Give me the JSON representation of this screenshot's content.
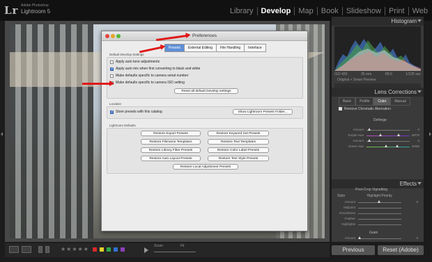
{
  "app": {
    "logo": "Lr",
    "vendor": "Adobe Photoshop",
    "product": "Lightroom 5",
    "modules": [
      "Library",
      "Develop",
      "Map",
      "Book",
      "Slideshow",
      "Print",
      "Web"
    ],
    "active_module": "Develop"
  },
  "right_panel": {
    "histogram_title": "Histogram",
    "hist_info": [
      "ISO 400",
      "35 mm",
      "f/8.0",
      "1/125 sec"
    ],
    "original_label": "Original + Smart Preview",
    "lens_title": "Lens Corrections",
    "lens_tabs": [
      "Basic",
      "Profile",
      "Color",
      "Manual"
    ],
    "lens_active_tab": "Color",
    "remove_ca": "Remove Chromatic Aberration",
    "defringe": "Defringe",
    "sliders": [
      {
        "label": "Amount",
        "value": "0"
      },
      {
        "label": "Purple Hue",
        "value": "28/70"
      },
      {
        "label": "Amount",
        "value": "0"
      },
      {
        "label": "Green Hue",
        "value": "40/60"
      }
    ],
    "effects_title": "Effects",
    "vignette_title": "Post-Crop Vignetting",
    "vignette_style_label": "Style",
    "vignette_style_value": "Highlight Priority",
    "vignette_sliders": [
      {
        "label": "Amount",
        "value": "0"
      },
      {
        "label": "Midpoint",
        "value": ""
      },
      {
        "label": "Roundness",
        "value": ""
      },
      {
        "label": "Feather",
        "value": ""
      },
      {
        "label": "Highlights",
        "value": ""
      }
    ],
    "grain_title": "Grain",
    "grain_amount_label": "Amount",
    "grain_amount_value": "0",
    "previous_button": "Previous",
    "reset_button": "Reset (Adobe)"
  },
  "toolbar": {
    "zoom_label": "Zoom",
    "fit_label": "Fit",
    "color_labels": [
      "#d92b2b",
      "#e8d02a",
      "#2ea84a",
      "#3270d2",
      "#8a3fb8"
    ]
  },
  "preferences": {
    "title": "Preferences",
    "tabs": [
      "Presets",
      "External Editing",
      "File Handling",
      "Interface"
    ],
    "active_tab": "Presets",
    "default_develop": {
      "label": "Default Develop Settings",
      "options": [
        {
          "label": "Apply auto tone adjustments",
          "checked": false
        },
        {
          "label": "Apply auto mix when first converting to black and white",
          "checked": true
        },
        {
          "label": "Make defaults specific to camera serial number",
          "checked": false
        },
        {
          "label": "Make defaults specific to camera ISO setting",
          "checked": false
        }
      ],
      "reset_button": "Reset all default Develop settings"
    },
    "location": {
      "label": "Location",
      "option": "Store presets with this catalog",
      "checked": true,
      "show_button": "Show Lightroom Presets Folder..."
    },
    "lightroom_defaults": {
      "label": "Lightroom Defaults",
      "buttons_left": [
        "Restore Export Presets",
        "Restore Filename Templates",
        "Restore Library Filter Presets",
        "Restore Auto Layout Presets"
      ],
      "buttons_right": [
        "Restore Keyword Set Presets",
        "Restore Text Templates",
        "Restore Color Label Presets",
        "Restore Text Style Presets"
      ],
      "bottom_button": "Restore Local Adjustment Presets"
    }
  }
}
